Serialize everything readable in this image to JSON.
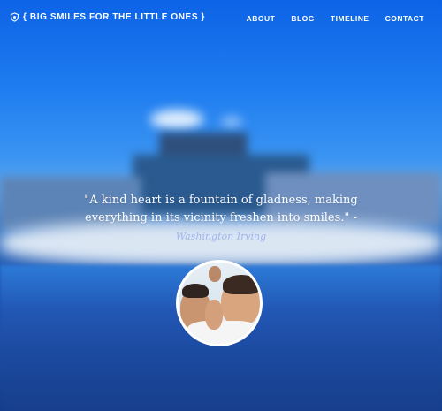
{
  "brand": {
    "icon": "shield-icon",
    "name": "{ BIG SMILES FOR THE LITTLE ONES }"
  },
  "nav": {
    "items": [
      {
        "label": "ABOUT"
      },
      {
        "label": "BLOG"
      },
      {
        "label": "TIMELINE"
      },
      {
        "label": "CONTACT"
      }
    ]
  },
  "hero": {
    "quote_line1": "\"A kind heart is a fountain of gladness, making",
    "quote_line2": "everything in its vicinity freshen into smiles.\" -",
    "author": "Washington Irving"
  },
  "colors": {
    "sky": "#1a6fd8",
    "author": "#9fb6f0",
    "text": "#ffffff"
  }
}
